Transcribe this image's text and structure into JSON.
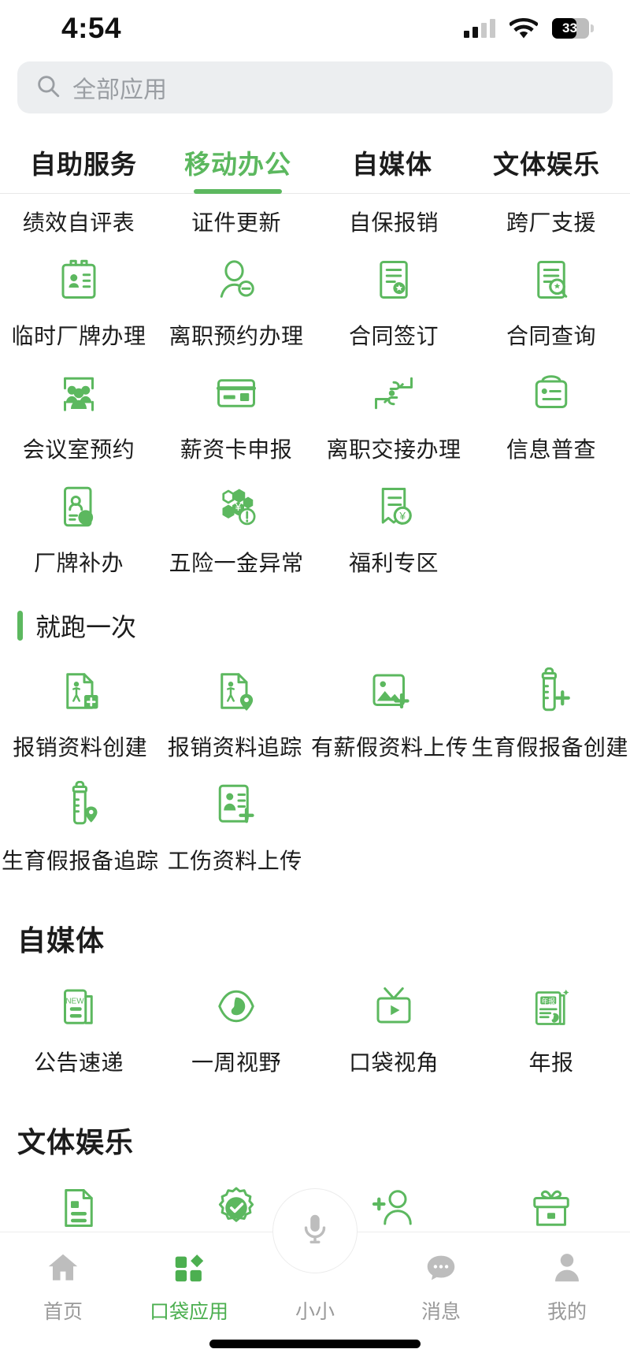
{
  "status_bar": {
    "time": "4:54",
    "battery_percent": "33",
    "icons": [
      "cellular-signal-icon",
      "wifi-icon",
      "battery-icon"
    ]
  },
  "search": {
    "placeholder": "全部应用",
    "icon": "search-icon"
  },
  "tabs": [
    {
      "label": "自助服务",
      "active": false
    },
    {
      "label": "移动办公",
      "active": true
    },
    {
      "label": "自媒体",
      "active": false
    },
    {
      "label": "文体娱乐",
      "active": false
    }
  ],
  "clipped_row": {
    "items": [
      {
        "label": "绩效自评表"
      },
      {
        "label": "证件更新"
      },
      {
        "label": "自保报销"
      },
      {
        "label": "跨厂支援"
      }
    ]
  },
  "mobile_office": {
    "items": [
      {
        "label": "临时厂牌办理",
        "icon": "id-badge-card-icon"
      },
      {
        "label": "离职预约办理",
        "icon": "person-minus-icon"
      },
      {
        "label": "合同签订",
        "icon": "document-seal-icon"
      },
      {
        "label": "合同查询",
        "icon": "document-search-icon"
      },
      {
        "label": "会议室预约",
        "icon": "meeting-room-people-icon"
      },
      {
        "label": "薪资卡申报",
        "icon": "bank-card-icon"
      },
      {
        "label": "离职交接办理",
        "icon": "handover-hands-icon"
      },
      {
        "label": "信息普查",
        "icon": "info-box-icon"
      },
      {
        "label": "厂牌补办",
        "icon": "badge-reissue-icon"
      },
      {
        "label": "五险一金异常",
        "icon": "insurance-hex-alert-icon"
      },
      {
        "label": "福利专区",
        "icon": "benefit-receipt-icon"
      }
    ]
  },
  "section_one_trip": {
    "title": "就跑一次",
    "items": [
      {
        "label": "报销资料创建",
        "icon": "claim-doc-plus-icon"
      },
      {
        "label": "报销资料追踪",
        "icon": "claim-doc-pin-icon"
      },
      {
        "label": "有薪假资料上传",
        "icon": "image-upload-plus-icon"
      },
      {
        "label": "生育假报备创建",
        "icon": "baby-bottle-plus-icon"
      },
      {
        "label": "生育假报备追踪",
        "icon": "baby-bottle-pin-icon"
      },
      {
        "label": "工伤资料上传",
        "icon": "injury-doc-plus-icon"
      }
    ]
  },
  "section_self_media": {
    "title": "自媒体",
    "items": [
      {
        "label": "公告速递",
        "icon": "news-new-icon"
      },
      {
        "label": "一周视野",
        "icon": "eye-icon"
      },
      {
        "label": "口袋视角",
        "icon": "tv-play-icon"
      },
      {
        "label": "年报",
        "icon": "annual-report-icon"
      }
    ]
  },
  "section_culture": {
    "title": "文体娱乐",
    "items": [
      {
        "label": "",
        "icon": "document-lines-icon"
      },
      {
        "label": "",
        "icon": "verified-badge-icon"
      },
      {
        "label": "",
        "icon": "add-person-icon"
      },
      {
        "label": "",
        "icon": "gift-icon"
      }
    ]
  },
  "bottom_nav": {
    "items": [
      {
        "label": "首页",
        "icon": "home-icon",
        "active": false
      },
      {
        "label": "口袋应用",
        "icon": "apps-grid-icon",
        "active": true
      },
      {
        "label": "小小",
        "icon": "microphone-icon",
        "active": false
      },
      {
        "label": "消息",
        "icon": "chat-bubble-icon",
        "active": false
      },
      {
        "label": "我的",
        "icon": "person-icon",
        "active": false
      }
    ]
  },
  "colors": {
    "brand_green": "#5cb85f",
    "nav_active": "#4caf50",
    "text": "#1c1c1c",
    "muted": "#9a9a9a",
    "search_bg": "#eceef0"
  }
}
